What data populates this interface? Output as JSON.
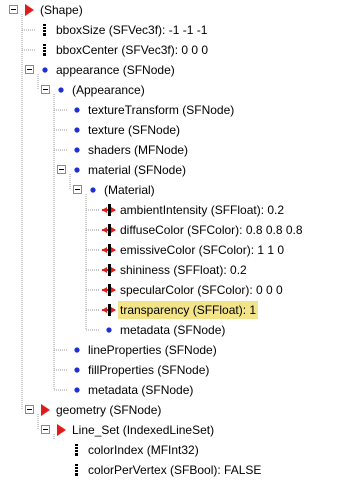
{
  "tree": {
    "nodes": [
      {
        "label": "(Shape)",
        "icon": "red-triangle-icon",
        "toggle": "expanded"
      },
      {
        "label": "bboxSize (SFVec3f): -1 -1 -1",
        "icon": "field-bar-icon",
        "toggle": "none"
      },
      {
        "label": "bboxCenter (SFVec3f):  0  0  0",
        "icon": "field-bar-icon",
        "toggle": "none"
      },
      {
        "label": "appearance (SFNode)",
        "icon": "blue-dot-icon",
        "toggle": "expanded"
      },
      {
        "label": "(Appearance)",
        "icon": "blue-dot-icon",
        "toggle": "expanded"
      },
      {
        "label": "textureTransform (SFNode)",
        "icon": "blue-dot-icon",
        "toggle": "none"
      },
      {
        "label": "texture (SFNode)",
        "icon": "blue-dot-icon",
        "toggle": "none"
      },
      {
        "label": "shaders (MFNode)",
        "icon": "blue-dot-icon",
        "toggle": "none"
      },
      {
        "label": "material (SFNode)",
        "icon": "blue-dot-icon",
        "toggle": "expanded"
      },
      {
        "label": "(Material)",
        "icon": "blue-dot-icon",
        "toggle": "expanded"
      },
      {
        "label": "ambientIntensity (SFFloat): 0.2",
        "icon": "exposed-field-icon",
        "toggle": "none"
      },
      {
        "label": "diffuseColor (SFColor): 0.8        0.8        0.8",
        "icon": "exposed-field-icon",
        "toggle": "none"
      },
      {
        "label": "emissiveColor (SFColor):  1  1  0",
        "icon": "exposed-field-icon",
        "toggle": "none"
      },
      {
        "label": "shininess (SFFloat): 0.2",
        "icon": "exposed-field-icon",
        "toggle": "none"
      },
      {
        "label": "specularColor (SFColor):  0  0  0",
        "icon": "exposed-field-icon",
        "toggle": "none"
      },
      {
        "label": "transparency (SFFloat): 1",
        "icon": "exposed-field-icon",
        "toggle": "none",
        "selected": true
      },
      {
        "label": "metadata (SFNode)",
        "icon": "blue-dot-icon",
        "toggle": "none"
      },
      {
        "label": "lineProperties (SFNode)",
        "icon": "blue-dot-icon",
        "toggle": "none"
      },
      {
        "label": "fillProperties (SFNode)",
        "icon": "blue-dot-icon",
        "toggle": "none"
      },
      {
        "label": "metadata (SFNode)",
        "icon": "blue-dot-icon",
        "toggle": "none"
      },
      {
        "label": "geometry (SFNode)",
        "icon": "red-triangle-icon",
        "toggle": "expanded"
      },
      {
        "label": "Line_Set (IndexedLineSet)",
        "icon": "red-triangle-icon",
        "toggle": "expanded"
      },
      {
        "label": "colorIndex (MFInt32)",
        "icon": "field-bar-icon",
        "toggle": "none"
      },
      {
        "label": "colorPerVertex (SFBool): FALSE",
        "icon": "field-bar-icon",
        "toggle": "none"
      }
    ]
  },
  "colors": {
    "selection": "#f3e48a",
    "node_blue": "#1f2fd6",
    "node_red": "#e31a1a",
    "guide": "#9a9a9a"
  }
}
